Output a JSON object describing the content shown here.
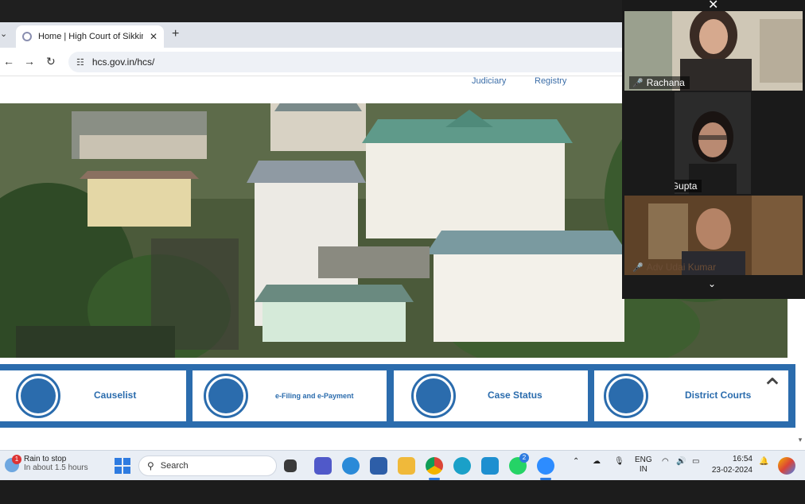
{
  "browser": {
    "tab_title": "Home | High Court of Sikkim",
    "tab_close": "✕",
    "new_tab": "+",
    "back": "←",
    "forward": "→",
    "reload": "↻",
    "url": "hcs.gov.in/hcs/"
  },
  "site": {
    "nav": [
      "Judiciary",
      "Registry"
    ],
    "cards": [
      {
        "label": "Causelist"
      },
      {
        "label": "e-Filing and e-Payment"
      },
      {
        "label": "Case Status"
      },
      {
        "label": "District Courts"
      }
    ],
    "scroll_up_glyph": "⌃"
  },
  "meeting": {
    "participants": [
      {
        "name": "Rachana",
        "muted": true
      },
      {
        "name": "Neha Gupta",
        "muted": true
      },
      {
        "name": "Adv Udai Kumar",
        "muted": true
      }
    ]
  },
  "taskbar": {
    "weather_title": "Rain to stop",
    "weather_sub": "In about 1.5 hours",
    "weather_badge": "1",
    "search_placeholder": "Search",
    "whatsapp_badge": "2",
    "language": "ENG",
    "region": "IN",
    "time": "16:54",
    "date": "23-02-2024"
  },
  "colors": {
    "site_accent": "#2b6cad",
    "taskbar_bg": "#e9eef5",
    "tab_strip": "#dfe3ea"
  }
}
